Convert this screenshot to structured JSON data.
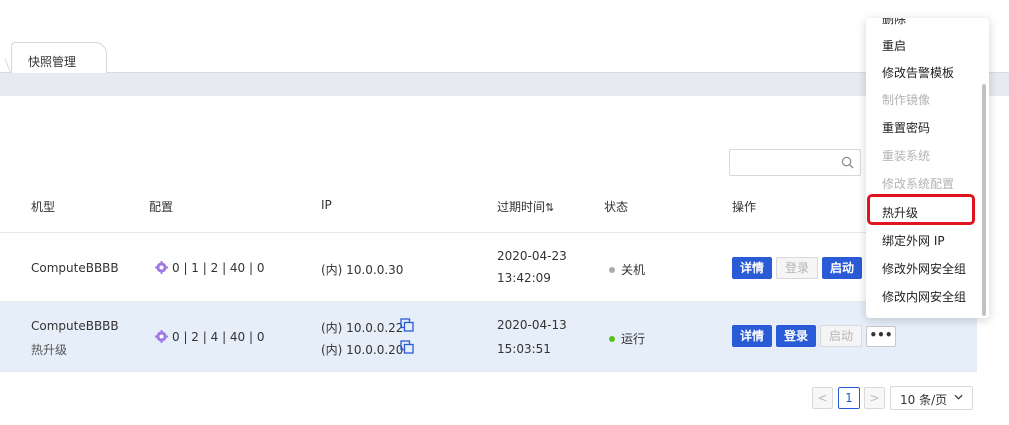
{
  "tabs": {
    "active": "快照管理"
  },
  "table": {
    "headers": {
      "model": "机型",
      "config": "配置",
      "ip": "IP",
      "expire": "过期时间",
      "sort_icon": "⇅",
      "status": "状态",
      "actions": "操作"
    },
    "rows": [
      {
        "model": "ComputeBBBB",
        "sub": "",
        "config": "0 | 1 | 2 | 40 | 0",
        "ip1": "(内) 10.0.0.30",
        "ip2": "",
        "date": "2020-04-23",
        "time": "13:42:09",
        "status": "关机",
        "status_color": "#aaaaaa",
        "btn_detail": "详情",
        "btn_login": "登录",
        "btn_start": "启动"
      },
      {
        "model": "ComputeBBBB",
        "sub": "热升级",
        "config": "0 | 2 | 4 | 40 | 0",
        "ip1": "(内) 10.0.0.22",
        "ip2": "(内) 10.0.0.20",
        "date": "2020-04-13",
        "time": "15:03:51",
        "status": "运行",
        "status_color": "#52c41a",
        "btn_detail": "详情",
        "btn_login": "登录",
        "btn_start": "启动",
        "btn_more": "•••"
      }
    ]
  },
  "pagination": {
    "prev": "<",
    "current": "1",
    "next": ">",
    "page_size": "10 条/页"
  },
  "menu": {
    "items": [
      {
        "label": "重启",
        "disabled": false
      },
      {
        "label": "修改告警模板",
        "disabled": false
      },
      {
        "label": "制作镜像",
        "disabled": true
      },
      {
        "label": "重置密码",
        "disabled": false
      },
      {
        "label": "重装系统",
        "disabled": true
      },
      {
        "label": "修改系统配置",
        "disabled": true
      },
      {
        "label": "热升级",
        "disabled": false,
        "highlighted": true
      },
      {
        "label": "绑定外网 IP",
        "disabled": false
      },
      {
        "label": "修改外网安全组",
        "disabled": false
      },
      {
        "label": "修改内网安全组",
        "disabled": false
      }
    ]
  },
  "colors": {
    "primary": "#2a5bd7",
    "highlight": "#e0141e",
    "selected_row": "#e6eef9"
  }
}
